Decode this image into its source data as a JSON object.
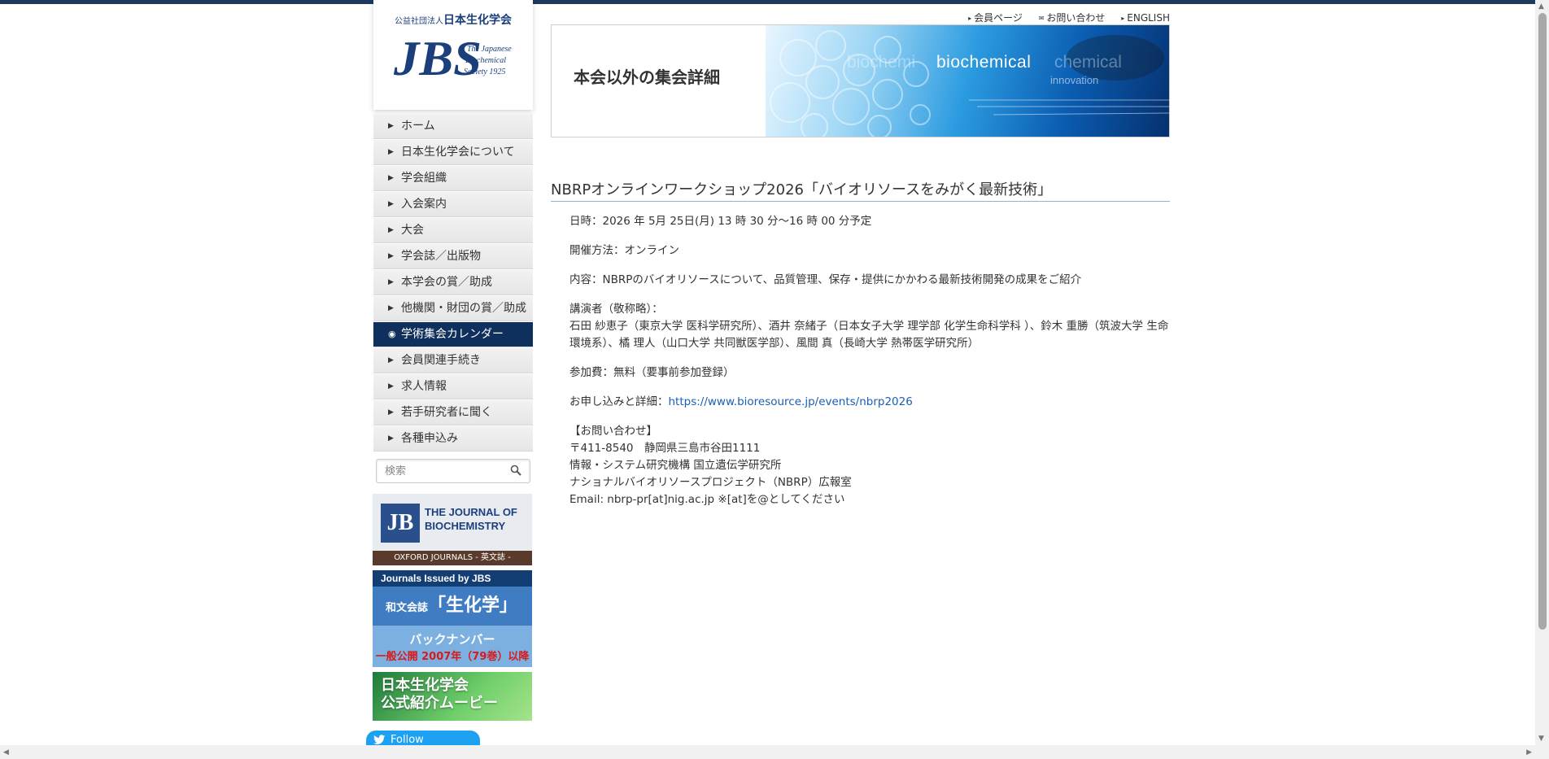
{
  "header": {
    "links": [
      {
        "mark": "▸",
        "label": "会員ページ"
      },
      {
        "mark": "✉",
        "label": "お問い合わせ"
      },
      {
        "mark": "▸",
        "label": "ENGLISH"
      }
    ]
  },
  "logo": {
    "org_prefix": "公益社団法人",
    "org_name": "日本生化学会",
    "mark": "JBS",
    "tagline": [
      "The Japanese",
      "Biochemical",
      "Society 1925"
    ]
  },
  "nav": {
    "items": [
      {
        "label": "ホーム",
        "active": false
      },
      {
        "label": "日本生化学会について",
        "active": false
      },
      {
        "label": "学会組織",
        "active": false
      },
      {
        "label": "入会案内",
        "active": false
      },
      {
        "label": "大会",
        "active": false
      },
      {
        "label": "学会誌／出版物",
        "active": false
      },
      {
        "label": "本学会の賞／助成",
        "active": false
      },
      {
        "label": "他機関・財団の賞／助成",
        "active": false
      },
      {
        "label": "学術集会カレンダー",
        "active": true
      },
      {
        "label": "会員関連手続き",
        "active": false
      },
      {
        "label": "求人情報",
        "active": false
      },
      {
        "label": "若手研究者に聞く",
        "active": false
      },
      {
        "label": "各種申込み",
        "active": false
      }
    ]
  },
  "search": {
    "placeholder": "検索"
  },
  "banners": {
    "jb": {
      "mark": "JB",
      "line1": "THE JOURNAL OF",
      "line2": "BIOCHEMISTRY",
      "footer": "OXFORD JOURNALS - 英文誌 -"
    },
    "seika": {
      "header": "Journals Issued by JBS",
      "small": "和文会誌",
      "big": "「生化学」",
      "line1": "バックナンバー",
      "line2": "一般公開 2007年（79巻）以降"
    },
    "movie": {
      "line1": "日本生化学会",
      "line2": "公式紹介ムービー"
    }
  },
  "follow": {
    "label": "Follow"
  },
  "hero": {
    "title": "本会以外の集会詳細",
    "word_left": "biochemi",
    "word": "biochemical",
    "word_right": "chemical",
    "sub": "innovation"
  },
  "event": {
    "title": "NBRPオンラインワークショップ2026「バイオリソースをみがく最新技術」",
    "date": "日時：2026 年 5月 25日(月) 13 時 30 分～16 時 00 分予定",
    "method": "開催方法：オンライン",
    "content": "内容：NBRPのバイオリソースについて、品質管理、保存・提供にかかわる最新技術開発の成果をご紹介",
    "speakers_label": "講演者（敬称略）：",
    "speakers": "石田 紗恵子（東京大学 医科学研究所）、酒井 奈緒子（日本女子大学 理学部 化学生命科学科 ）、鈴木 重勝（筑波大学 生命環境系）、橘 理人（山口大学 共同獣医学部）、風間 真（長崎大学 熱帯医学研究所）",
    "fee": "参加費：無料（要事前参加登録）",
    "apply_label": "お申し込みと詳細：",
    "apply_url": "https://www.bioresource.jp/events/nbrp2026",
    "contact_title": "【お問い合わせ】",
    "contact_address": "〒411-8540　静岡県三島市谷田1111",
    "contact_org1": "情報・システム研究機構 国立遺伝学研究所",
    "contact_org2": "ナショナルバイオリソースプロジェクト（NBRP）広報室",
    "contact_email": "Email: nbrp-pr[at]nig.ac.jp ※[at]を@としてください"
  },
  "colors": {
    "top_bar": "#1c3a5e",
    "nav_active": "#0f2f5c",
    "link": "#1a5fb4",
    "title_rule": "#8fb3d9"
  }
}
